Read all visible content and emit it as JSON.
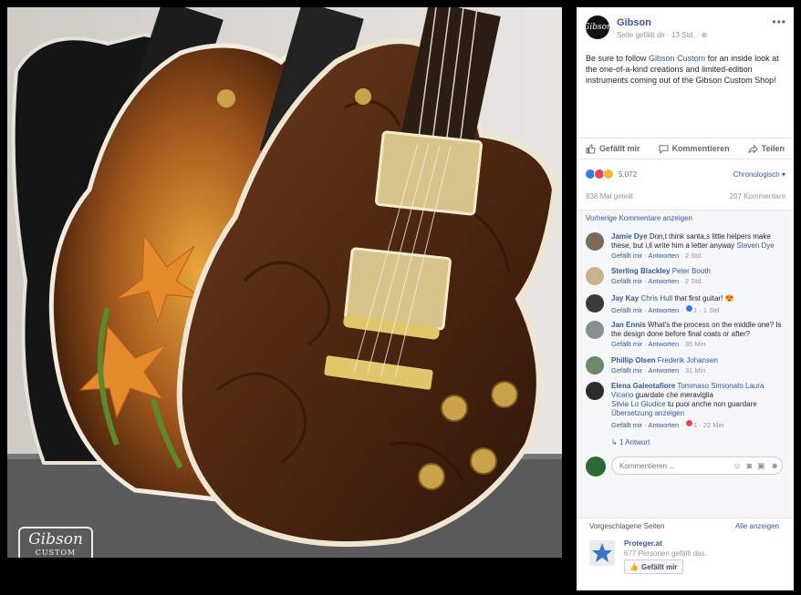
{
  "photo": {
    "watermark_logo": "Gibson",
    "watermark_sub": "CUSTOM"
  },
  "post": {
    "page_name": "Gibson",
    "meta": "Seite gefällt dir · 13 Std. · ",
    "more_icon": "more-horizontal-icon",
    "text_1": "Be sure to follow ",
    "text_link": "Gibson Custom",
    "text_2": " for an inside look at the one-of-a-kind creations and limited-edition instruments coming out of the Gibson Custom Shop!"
  },
  "actions": {
    "like": "Gefällt mir",
    "comment": "Kommentieren",
    "share": "Teilen"
  },
  "reactions": {
    "count": "5.072",
    "sort": "Chronologisch ▾",
    "shares": "838 Mal geteilt",
    "comments": "207 Kommentare"
  },
  "comments": {
    "previous": "Vorherige Kommentare anzeigen",
    "items": [
      {
        "author": "Jamie Dye",
        "text": " Don,t think santa,s little helpers make these, but i,ll write him a letter anyway ",
        "mention": "Steven Dye",
        "like": "Gefällt mir",
        "reply": "Antworten",
        "time": "2 Std."
      },
      {
        "author": "Sterling Blackley",
        "text": " ",
        "mention": "Peter Booth",
        "like": "Gefällt mir",
        "reply": "Antworten",
        "time": "2 Std."
      },
      {
        "author": "Jay Kay",
        "text": " that first guitar! 😍",
        "mention": "Chris Hull",
        "like": "Gefällt mir",
        "reply": "Antworten",
        "time": "1 Std",
        "reactions": "1"
      },
      {
        "author": "Jan Ennis",
        "text": " What's the process on the middle one? Is the design done before final coats or after?",
        "mention": "",
        "like": "Gefällt mir",
        "reply": "Antworten",
        "time": "35 Min"
      },
      {
        "author": "Phillip Olsen",
        "text": " ",
        "mention": "Frederik Johansen",
        "like": "Gefällt mir",
        "reply": "Antworten",
        "time": "31 Min"
      },
      {
        "author": "Elena Galeotafiore",
        "text": " guardate che meraviglia",
        "mention": "Tommaso Simionato Laura Vicario",
        "mention2": "Silvia Lo Giudice",
        "text2": " tu puoi anche non guardare",
        "translate": "Übersetzung anzeigen",
        "like": "Gefällt mir",
        "reply": "Antworten",
        "time": "22 Min",
        "reactions": "1"
      }
    ],
    "replies": "1 Antwort",
    "input_placeholder": "Kommentieren ..."
  },
  "suggested": {
    "title": "Vorgeschlagene Seiten",
    "see_all": "Alle anzeigen",
    "page_name": "Proteger.at",
    "likes": "677 Personen gefällt das.",
    "like_button": "Gefällt mir"
  },
  "colors": {
    "link": "#365899",
    "like_blue": "#2a7cf0",
    "love_red": "#f33e58",
    "wow_yellow": "#f7b928"
  }
}
